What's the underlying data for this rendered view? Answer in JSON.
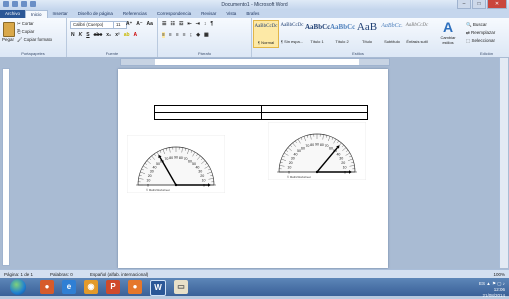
{
  "window": {
    "title": "Documento1 - Microsoft Word",
    "controls": {
      "minimize": "–",
      "maximize": "□",
      "close": "✕"
    }
  },
  "tabs": [
    "Archivo",
    "Inicio",
    "Insertar",
    "Diseño de página",
    "Referencias",
    "Correspondencia",
    "Revisar",
    "Vista",
    "Brafes"
  ],
  "active_tab_index": 1,
  "clipboard": {
    "paste": "Pegar",
    "cut": "Cortar",
    "copy": "Copiar",
    "format_painter": "Copiar formato",
    "group": "Portapapeles"
  },
  "font": {
    "name": "Calibri (Cuerpo)",
    "size": "11",
    "group": "Fuente"
  },
  "paragraph": {
    "group": "Párrafo"
  },
  "styles": {
    "group": "Estilos",
    "items": [
      {
        "sample": "AaBbCcDc",
        "name": "¶ Normal"
      },
      {
        "sample": "AaBbCcDc",
        "name": "¶ Sin espa..."
      },
      {
        "sample": "AaBbCc",
        "name": "Título 1"
      },
      {
        "sample": "AaBbCc",
        "name": "Título 2"
      },
      {
        "sample": "AaB",
        "name": "Título"
      },
      {
        "sample": "AaBbCc.",
        "name": "Subtítulo"
      },
      {
        "sample": "AaBbCcDc",
        "name": "Énfasis sutil"
      }
    ],
    "change_styles": "Cambiar estilos"
  },
  "editing": {
    "find": "Buscar",
    "replace": "Reemplazar",
    "select": "Seleccionar",
    "group": "Edición"
  },
  "protractor": {
    "labels": [
      "90",
      "80",
      "70",
      "60",
      "50",
      "40",
      "30",
      "20",
      "10",
      "0"
    ],
    "small_text": "© MathsWorksheet"
  },
  "statusbar": {
    "page": "Página: 1 de 1",
    "words": "Palabras: 0",
    "language": "Español (alfab. internacional)",
    "zoom": "100%"
  },
  "tray": {
    "lang": "ES",
    "time": "12:06",
    "date": "21/08/2014"
  }
}
